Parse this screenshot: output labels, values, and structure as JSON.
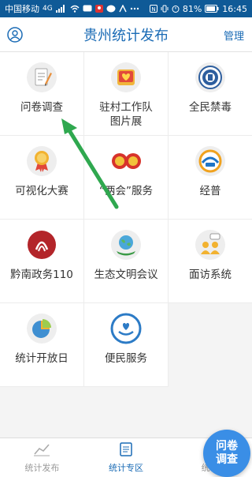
{
  "status_bar": {
    "carrier": "中国移动",
    "network": "4G",
    "battery": "81%",
    "time": "16:45"
  },
  "header": {
    "title": "贵州统计发布",
    "manage_label": "管理"
  },
  "grid": [
    {
      "label": "问卷调查",
      "icon": "questionnaire-icon"
    },
    {
      "label": "驻村工作队\n图片展",
      "icon": "photo-album-icon"
    },
    {
      "label": "全民禁毒",
      "icon": "anti-drug-emblem-icon"
    },
    {
      "label": "可视化大赛",
      "icon": "medal-icon"
    },
    {
      "label": "“两会”服务",
      "icon": "two-sessions-emblem-icon"
    },
    {
      "label": "经普",
      "icon": "census-logo-icon"
    },
    {
      "label": "黔南政务110",
      "icon": "qiannan-gov-icon"
    },
    {
      "label": "生态文明会议",
      "icon": "ecology-globe-icon"
    },
    {
      "label": "面访系统",
      "icon": "interview-people-icon"
    },
    {
      "label": "统计开放日",
      "icon": "pie-chart-icon"
    },
    {
      "label": "便民服务",
      "icon": "service-hand-icon"
    }
  ],
  "tabbar": [
    {
      "label": "统计发布",
      "icon": "line-chart-icon",
      "active": false
    },
    {
      "label": "统计专区",
      "icon": "document-icon",
      "active": true
    },
    {
      "label": "统计",
      "icon": "more-icon",
      "active": false
    }
  ],
  "float_button": {
    "line1": "问卷",
    "line2": "调查"
  },
  "colors": {
    "primary": "#1a6bb5",
    "status_bar": "#0f5a97",
    "float_button": "#3a8ee6",
    "arrow": "#2fa84f"
  }
}
